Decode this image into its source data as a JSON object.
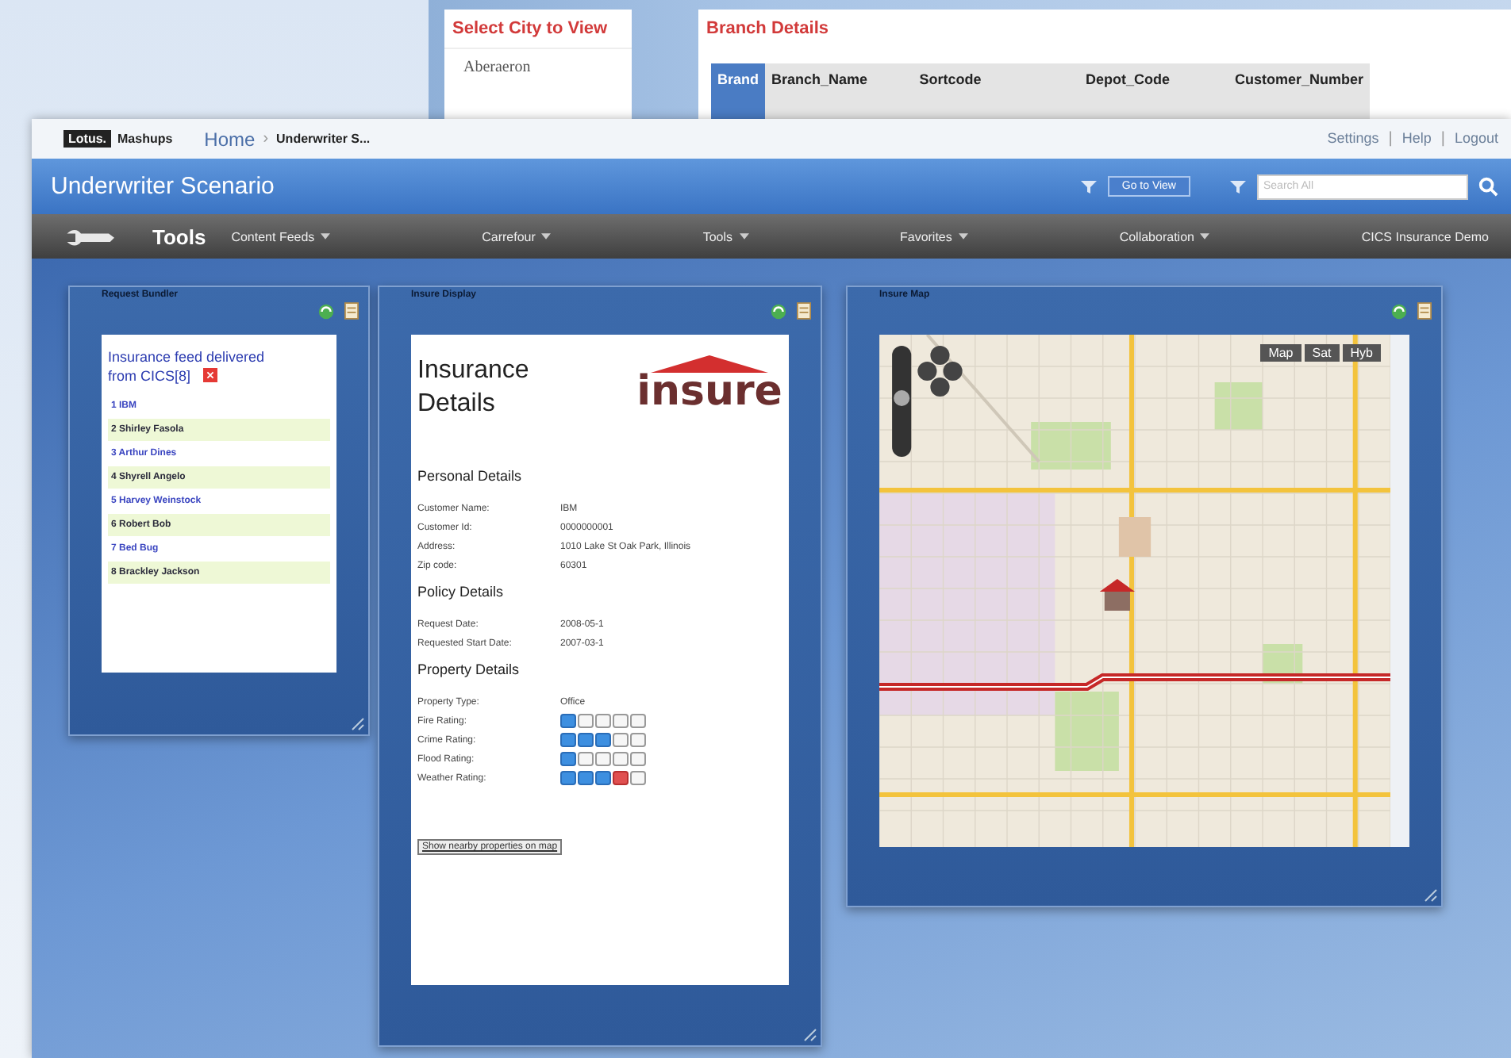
{
  "background_window": {
    "city_panel": {
      "title": "Select City to View",
      "cities": [
        "Aberaeron"
      ]
    },
    "branch_panel": {
      "title": "Branch Details",
      "columns": [
        {
          "label": "Brand",
          "selected": true
        },
        {
          "label": "Branch_Name",
          "selected": false
        },
        {
          "label": "Sortcode",
          "selected": false
        },
        {
          "label": "Depot_Code",
          "selected": false
        },
        {
          "label": "Customer_Number",
          "selected": false
        }
      ]
    }
  },
  "header": {
    "logo": {
      "badge": "Lotus.",
      "name": "Mashups"
    },
    "breadcrumb": [
      "Home",
      "Underwriter S..."
    ],
    "breadcrumb_separator": "›",
    "links": [
      "Settings",
      "Help",
      "Logout"
    ],
    "link_separator": "|"
  },
  "title_bar": {
    "title": "Underwriter Scenario",
    "go_button": "Go to View",
    "search": {
      "placeholder": "Search All"
    }
  },
  "toolbar": {
    "label": "Tools",
    "menus": [
      "Content Feeds",
      "Carrefour",
      "Tools",
      "Favorites",
      "Collaboration",
      "CICS Insurance Demo"
    ]
  },
  "widgets": {
    "bundler": {
      "title": "Request Bundler",
      "feed_title": "Insurance feed delivered from CICS[8]",
      "items": [
        "1 IBM",
        "2 Shirley Fasola",
        "3 Arthur Dines",
        "4 Shyrell Angelo",
        "5 Harvey Weinstock",
        "6 Robert Bob",
        "7 Bed Bug",
        "8 Brackley Jackson"
      ]
    },
    "display": {
      "title": "Insure Display",
      "heading": "Insurance Details",
      "logo": "insure",
      "sections": [
        {
          "title": "Personal Details",
          "fields": [
            {
              "kind": "text",
              "label": "Customer Name:",
              "value": "IBM"
            },
            {
              "kind": "text",
              "label": "Customer Id:",
              "value": "0000000001"
            },
            {
              "kind": "text",
              "label": "Address:",
              "value": "1010 Lake St Oak Park, Illinois"
            },
            {
              "kind": "text",
              "label": "Zip code:",
              "value": "60301"
            }
          ]
        },
        {
          "title": "Policy Details",
          "fields": [
            {
              "kind": "text",
              "label": "Request Date:",
              "value": "2008-05-1"
            },
            {
              "kind": "text",
              "label": "Requested Start Date:",
              "value": "2007-03-1"
            }
          ]
        },
        {
          "title": "Property Details",
          "fields": [
            {
              "kind": "text",
              "label": "Property Type:",
              "value": "Office"
            },
            {
              "kind": "rating",
              "label": "Fire Rating:",
              "stars": 1,
              "alert": false
            },
            {
              "kind": "rating",
              "label": "Crime Rating:",
              "stars": 3,
              "alert": false
            },
            {
              "kind": "rating",
              "label": "Flood Rating:",
              "stars": 1,
              "alert": false
            },
            {
              "kind": "rating",
              "label": "Weather Rating:",
              "stars": 3,
              "alert": true
            }
          ]
        }
      ],
      "link_button": "Show nearby properties on map"
    },
    "map": {
      "title": "Insure Map",
      "map_types": [
        "Map",
        "Sat",
        "Hyb"
      ]
    }
  }
}
